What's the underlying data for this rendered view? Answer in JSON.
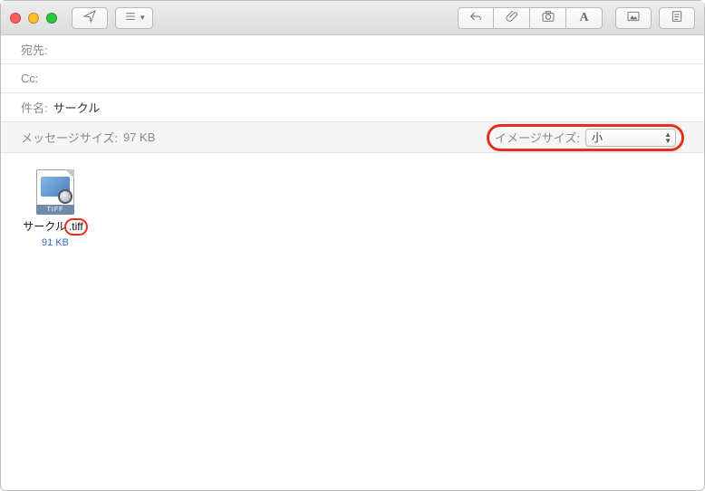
{
  "toolbar": {
    "send_icon": "paper-plane",
    "template_icon": "list",
    "reply_icon": "reply",
    "attach_icon": "paperclip",
    "photo_icon": "camera",
    "format_icon": "A",
    "media_icon": "picture",
    "stationery_icon": "page"
  },
  "fields": {
    "to_label": "宛先:",
    "to_value": "",
    "cc_label": "Cc:",
    "cc_value": "",
    "subject_label": "件名:",
    "subject_value": "サークル"
  },
  "info": {
    "message_size_label": "メッセージサイズ:",
    "message_size_value": "97 KB",
    "image_size_label": "イメージサイズ:",
    "image_size_value": "小"
  },
  "attachment": {
    "icon_tag": "TIFF",
    "name_base": "サークル",
    "name_ext": ".tiff",
    "size": "91 KB"
  }
}
